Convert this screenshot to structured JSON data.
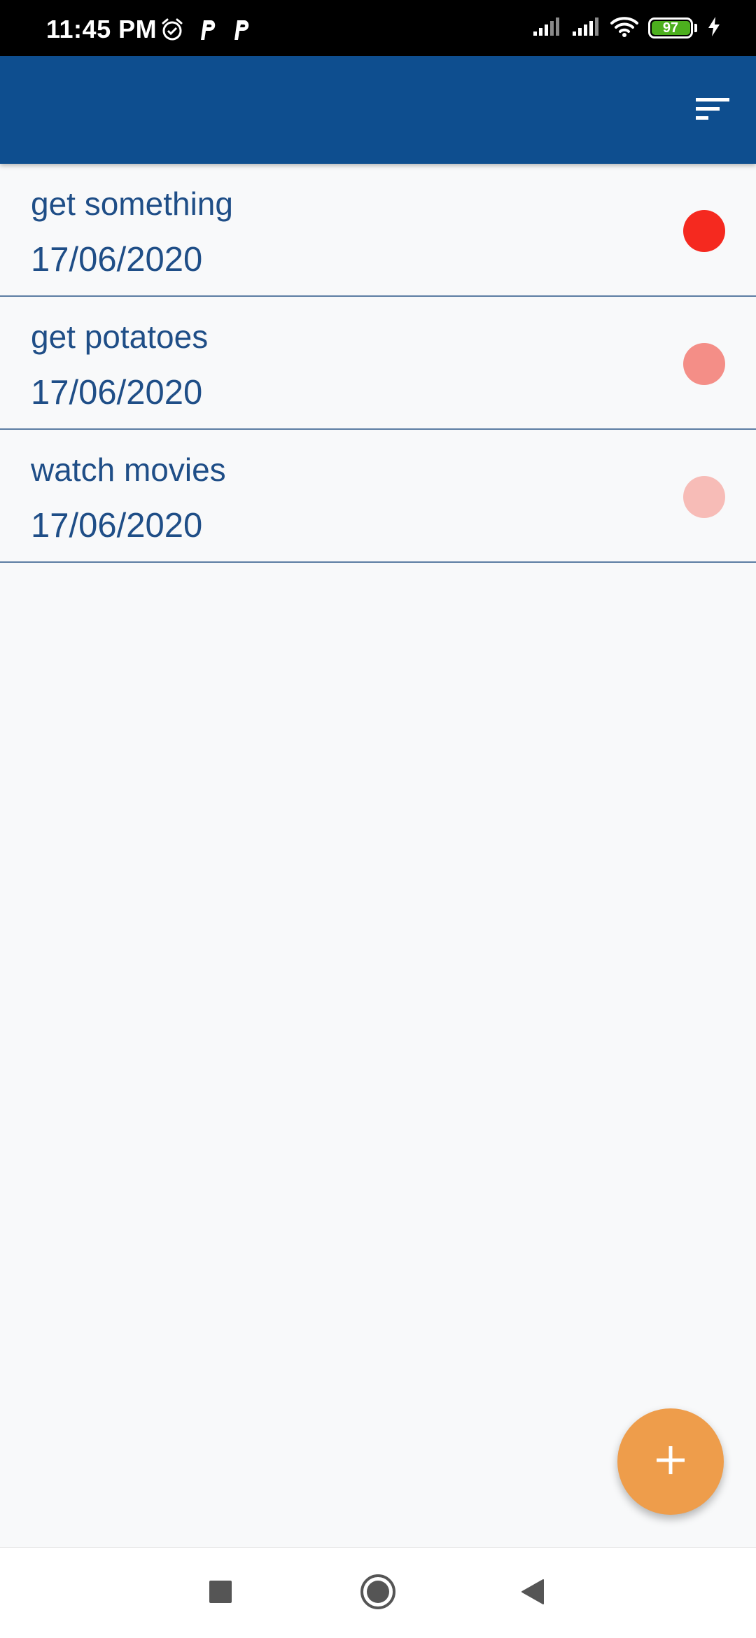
{
  "status_bar": {
    "time": "11:45 PM",
    "battery_level": "97",
    "left_icons": [
      "alarm-icon",
      "parking-icon",
      "parking-icon"
    ],
    "right_icons": [
      "signal-icon",
      "signal-icon",
      "wifi-icon",
      "battery-icon",
      "charging-icon"
    ]
  },
  "app_bar": {
    "color": "#0e4e8f",
    "sort_icon": "sort-icon"
  },
  "tasks": [
    {
      "title": "get something",
      "date": "17/06/2020",
      "priority_color": "#f5291f"
    },
    {
      "title": "get potatoes",
      "date": "17/06/2020",
      "priority_color": "#f48e87"
    },
    {
      "title": "watch movies",
      "date": "17/06/2020",
      "priority_color": "#f7bcb7"
    }
  ],
  "fab": {
    "icon": "plus-icon",
    "color": "#ee9d4b"
  },
  "nav_bar": {
    "buttons": [
      "recents-square-icon",
      "home-circle-icon",
      "back-triangle-icon"
    ]
  },
  "theme": {
    "text_color": "#1f4e87",
    "divider_color": "#5c7da3",
    "background": "#f8f9fa",
    "battery_color": "#4caf1e"
  }
}
